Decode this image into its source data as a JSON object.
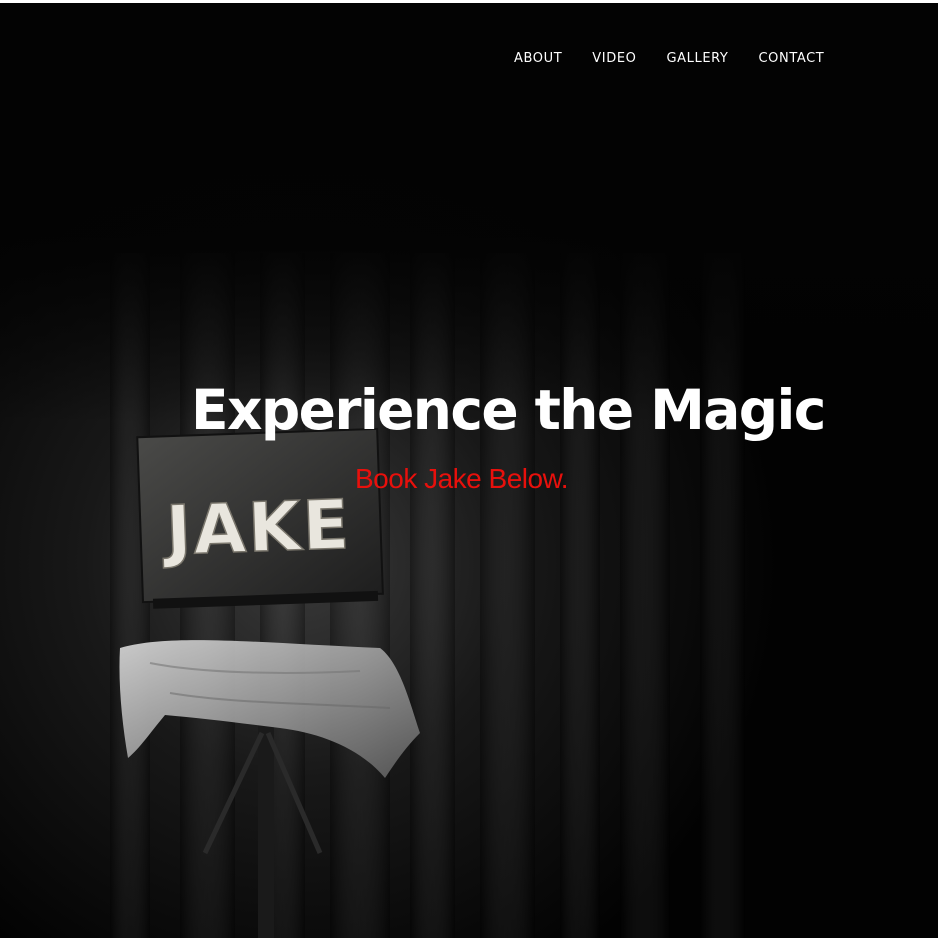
{
  "nav": {
    "items": [
      {
        "label": "ABOUT"
      },
      {
        "label": "VIDEO"
      },
      {
        "label": "GALLERY"
      },
      {
        "label": "CONTACT"
      }
    ]
  },
  "hero": {
    "headline": "Experience the Magic",
    "subheadline": "Book Jake Below.",
    "sign_text": "JAKE",
    "colors": {
      "background": "#000000",
      "headline": "#ffffff",
      "subheadline": "#e8100c"
    }
  }
}
